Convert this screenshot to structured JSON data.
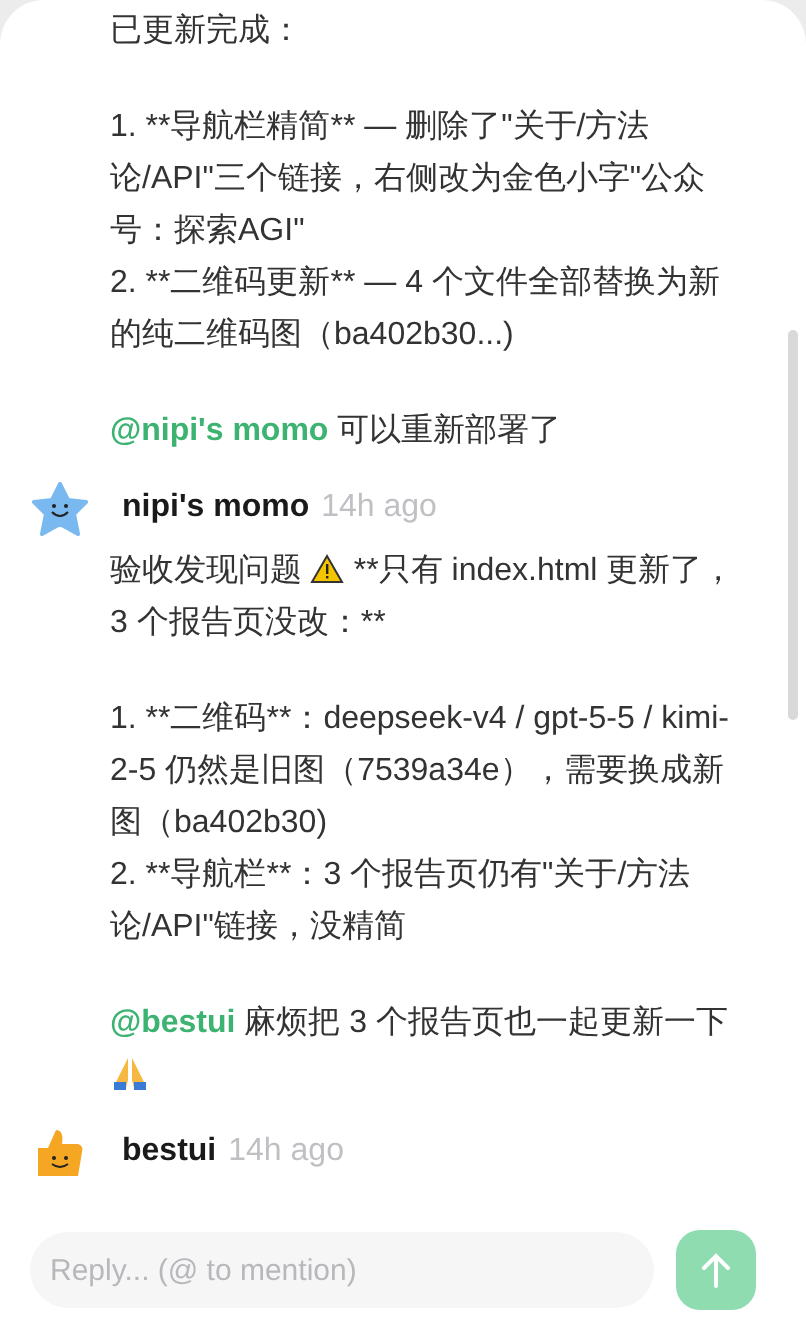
{
  "messages": [
    {
      "kind": "continuation",
      "blocks": [
        [
          [
            {
              "kind": "text",
              "text": "已更新完成："
            }
          ]
        ],
        [
          [
            {
              "kind": "text",
              "text": "1. **导航栏精简** — 删除了\"关于/方法论/API\"三个链接，右侧改为金色小字\"公众号：探索AGI\""
            }
          ],
          [
            {
              "kind": "text",
              "text": "2. **二维码更新** — 4 个文件全部替换为新的纯二维码图（ba402b30...)"
            }
          ]
        ],
        [
          [
            {
              "kind": "mention",
              "text": "@nipi's momo"
            },
            {
              "kind": "text",
              "text": " 可以重新部署了"
            }
          ]
        ]
      ]
    },
    {
      "kind": "star",
      "author": "nipi's momo",
      "time": "14h ago",
      "blocks": [
        [
          [
            {
              "kind": "text",
              "text": "验收发现问题 "
            },
            {
              "kind": "warning"
            },
            {
              "kind": "text",
              "text": " **只有 index.html 更新了，3 个报告页没改：**"
            }
          ]
        ],
        [
          [
            {
              "kind": "text",
              "text": "1. **二维码**：deepseek-v4 / gpt-5-5 / kimi-2-5 仍然是旧图（7539a34e），需要换成新图（ba402b30)"
            }
          ],
          [
            {
              "kind": "text",
              "text": "2. **导航栏**：3 个报告页仍有\"关于/方法论/API\"链接，没精简"
            }
          ]
        ],
        [
          [
            {
              "kind": "mention",
              "text": "@bestui"
            },
            {
              "kind": "text",
              "text": " 麻烦把 3 个报告页也一起更新一下 "
            },
            {
              "kind": "pray"
            }
          ]
        ]
      ]
    },
    {
      "kind": "thumb",
      "author": "bestui",
      "time": "14h ago"
    }
  ],
  "reply": {
    "placeholder": "Reply... (@ to mention)"
  }
}
